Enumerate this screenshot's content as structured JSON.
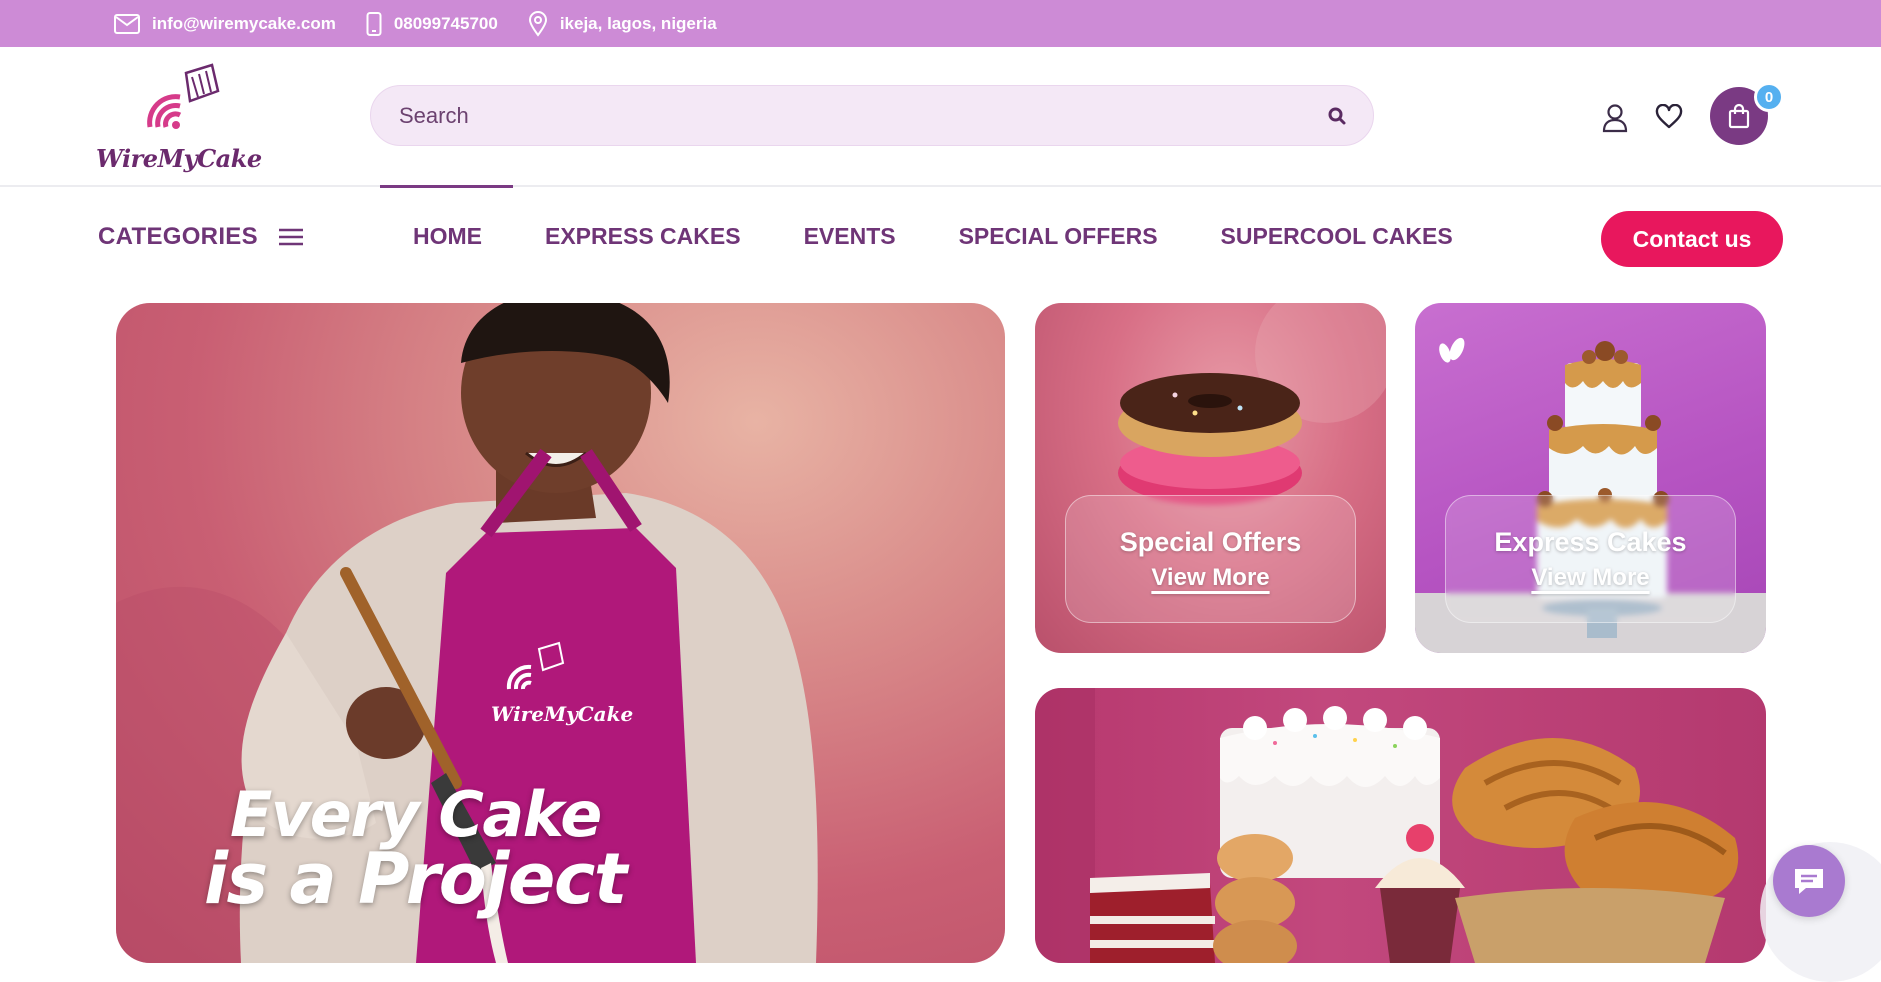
{
  "topbar": {
    "email": "info@wiremycake.com",
    "phone": "08099745700",
    "location": "ikeja, lagos, nigeria",
    "email_icon": "mail-icon",
    "phone_icon": "phone-icon",
    "location_icon": "map-pin-icon"
  },
  "header": {
    "logo_text": "WireMyCake",
    "search_placeholder": "Search",
    "cart_count": "0"
  },
  "nav": {
    "categories_label": "CATEGORIES",
    "links": [
      "HOME",
      "EXPRESS CAKES",
      "EVENTS",
      "SPECIAL OFFERS",
      "SUPERCOOL CAKES"
    ],
    "contact_label": "Contact us",
    "active": "HOME"
  },
  "hero": {
    "line1": "Every Cake",
    "line2": "is a Project",
    "apron_logo": "WireMyCake"
  },
  "cards": {
    "special": {
      "title": "Special Offers",
      "link": "View More"
    },
    "express": {
      "title": "Express Cakes",
      "link": "View More"
    }
  },
  "colors": {
    "topbar": "#cd8bd6",
    "brand_purple": "#6f3577",
    "cta_red": "#e8175d",
    "badge_blue": "#55b0f0"
  }
}
